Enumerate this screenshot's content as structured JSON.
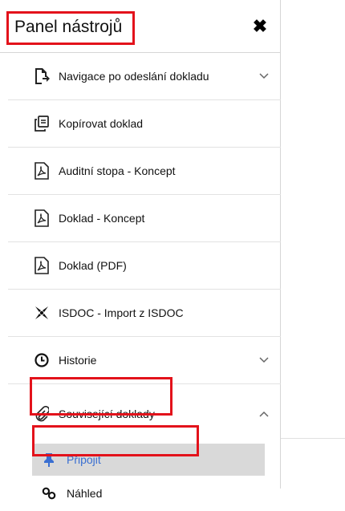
{
  "panel": {
    "title": "Panel nástrojů",
    "close_icon": "close-icon"
  },
  "items": [
    {
      "label": "Navigace po odeslání dokladu",
      "icon": "document-export-icon",
      "chevron": "down"
    },
    {
      "label": "Kopírovat doklad",
      "icon": "copy-icon"
    },
    {
      "label": "Auditní stopa - Koncept",
      "icon": "pdf-icon"
    },
    {
      "label": "Doklad - Koncept",
      "icon": "pdf-icon"
    },
    {
      "label": "Doklad (PDF)",
      "icon": "pdf-icon"
    },
    {
      "label": "ISDOC - Import z ISDOC",
      "icon": "isdoc-icon"
    },
    {
      "label": "Historie",
      "icon": "clock-icon",
      "chevron": "down"
    },
    {
      "label": "Související doklady",
      "icon": "paperclip-icon",
      "chevron": "up"
    }
  ],
  "subitems": [
    {
      "label": "Připojit",
      "icon": "pin-icon",
      "active": true,
      "accent": "#3a6fd1"
    },
    {
      "label": "Náhled",
      "icon": "link-icon",
      "active": false
    }
  ],
  "highlight_color": "#e3121b"
}
